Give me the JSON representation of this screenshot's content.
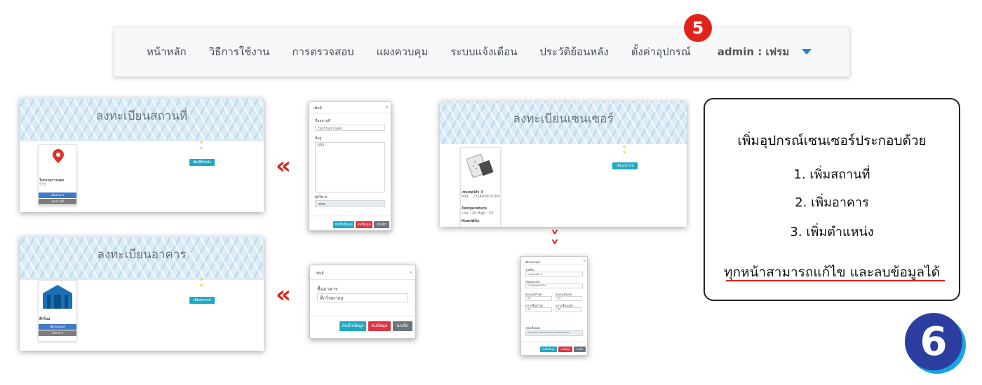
{
  "nav": {
    "items": [
      "หน้าหลัก",
      "วิธีการใช้งาน",
      "การตรวจสอบ",
      "แผงควบคุม",
      "ระบบแจ้งเตือน",
      "ประวัติย้อนหลัง",
      "ตั้งค่าอุปกรณ์"
    ],
    "user": "admin : เฟรม"
  },
  "step_badges": {
    "five": "5",
    "six": "6"
  },
  "panels": {
    "location": {
      "title": "ลงทะเบียนสถานที่",
      "card_name": "ใบกรรมการแตก",
      "card_sub": "555",
      "btn_primary": "เพิ่มอาคาร",
      "btn_secondary": "ลบสถานที่",
      "add_button": "เพิ่มที่ตั้งหลัก"
    },
    "building": {
      "title": "ลงทะเบียนอาคาร",
      "card_name": "ตึกใหม่",
      "btn_primary": "เพิ่มเซนเซอร์",
      "btn_secondary": "ลบอาคาร",
      "add_button": "เพิ่มอุปกรณ์"
    },
    "sensor": {
      "title": "ลงทะเบียนเซนเซอร์",
      "card_name": "เซนเซอร์ตัว 3",
      "mac": "MAC : 2354456S9784",
      "label_temp": "Temperature",
      "temp_value": "Low : 20 High : 50",
      "label_hum": "Humidity",
      "add_button": "เพิ่มอุปกรณ์"
    }
  },
  "modals": {
    "location": {
      "header": "เพิ่มที่",
      "label_name": "ชื่อสถานที่",
      "value_name": "ใบกรรมการแตก",
      "label_addr": "ที่อยู่",
      "value_addr": "555",
      "label_owner": "ผู้บริหาร",
      "value_owner": "เฟรม",
      "btn_save": "บันทึกข้อมูล",
      "btn_delete": "ลบข้อมูล",
      "btn_cancel": "ยกเลิก"
    },
    "building": {
      "header": "เพิ่มที่",
      "label_name": "ชื่ออาคาร",
      "value_name": "ตึกวิทยาลย",
      "btn_save": "บันทึกข้อมูล",
      "btn_delete": "ลบข้อมูล",
      "btn_cancel": "ยกเลิก"
    },
    "sensor": {
      "header": "เพิ่มเซนเซอร์",
      "label_name": "รุ่นที่ชื่อ",
      "value_name": "เซนเซอร์ตัว 3",
      "label_mac": "รหัสอุปกรณ์",
      "value_mac": "2354456S9784",
      "label_temp_low": "อุณหภูมิต่ำสุด",
      "value_temp_low": "20",
      "label_temp_high": "อุณหภูมิสูงสุด",
      "value_temp_high": "50",
      "label_hum_low": "ความชื้นต่ำสุด",
      "value_hum_low": "30",
      "label_hum_high": "ความชื้นสูงสุด",
      "value_hum_high": "60",
      "label_token": "รหัสเชื่อมต่อ",
      "value_token": "1fwead1b-d79f-1e9-9e69-e9dbad3a61e",
      "btn_save": "บันทึกข้อมูล",
      "btn_delete": "ลบข้อมูล",
      "btn_cancel": "ยกเลิก"
    }
  },
  "info_box": {
    "title": "เพิ่มอุปกรณ์เซนเซอร์ประกอบด้วย",
    "items": [
      "1. เพิ่มสถานที่",
      "2. เพิ่มอาคาร",
      "3. เพิ่มตำแหน่ง"
    ],
    "note": "ทุกหน้าสามารถแก้ไข และลบข้อมูลได้"
  },
  "colors": {
    "accent_red": "#e2231a",
    "badge_blue": "#2c3ea0",
    "teal_button": "#1fa8c1",
    "chevron_yellow": "#f6c000"
  }
}
